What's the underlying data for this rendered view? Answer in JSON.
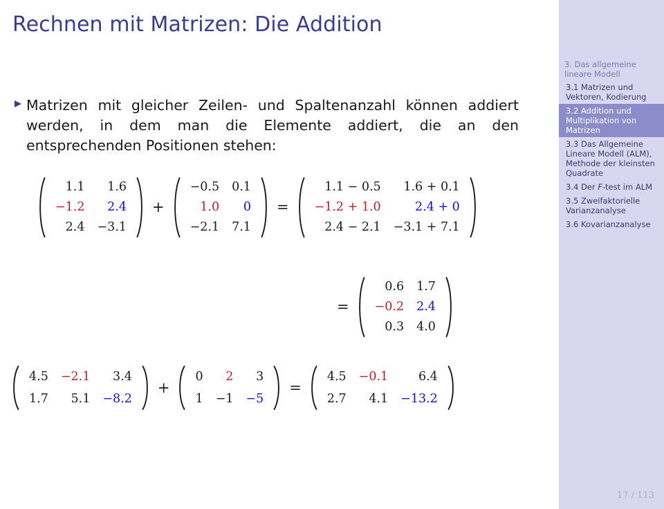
{
  "slide": {
    "title": "Rechnen mit Matrizen: Die Addition",
    "page_number": "17 / 113"
  },
  "bullet": {
    "marker": "triangle-right-bullet",
    "text": "Matrizen mit gleicher Zeilen- und Spaltenanzahl können addiert werden, in dem man die Elemente addiert, die an den entsprechenden Positionen stehen:"
  },
  "colors": {
    "title": "#3b3b8f",
    "bullet_marker": "#3b3b8f",
    "sidebar_bg": "#d7d7ef",
    "sidebar_active_bg": "#8c8cca",
    "sidebar_section": "#7a7ab8",
    "sidebar_item": "#3b3b6b",
    "math_red": "#c01c28",
    "math_blue": "#1111cc",
    "math_black": "#1a1a1a",
    "page_number": "#a9a9cc"
  },
  "sidebar": {
    "section": "3. Das allgemeine lineare Modell",
    "items": [
      {
        "label": "3.1 Matrizen und Vektoren, Kodierung",
        "active": false
      },
      {
        "label": "3.2 Addition und Multiplikation von Matrizen",
        "active": true
      },
      {
        "label": "3.3 Das Allgemeine Lineare Modell (ALM), Methode der kleinsten Quadrate",
        "active": false
      },
      {
        "label": "3.4 Der F-test im ALM",
        "active": false,
        "italic_part": "F"
      },
      {
        "label": "3.5 Zweifaktorielle Varianzanalyse",
        "active": false
      },
      {
        "label": "3.6 Kovarianzanalyse",
        "active": false
      }
    ]
  },
  "equations": [
    {
      "id": "equation-1",
      "terms": [
        {
          "kind": "matrix",
          "rows": 3,
          "cols": 2,
          "cells": [
            [
              {
                "t": "1.1",
                "c": "blk"
              },
              {
                "t": "1.6",
                "c": "blk"
              }
            ],
            [
              {
                "t": "−1.2",
                "c": "red"
              },
              {
                "t": "2.4",
                "c": "blue"
              }
            ],
            [
              {
                "t": "2.4",
                "c": "blk"
              },
              {
                "t": "−3.1",
                "c": "blk"
              }
            ]
          ]
        },
        {
          "kind": "op",
          "t": "+"
        },
        {
          "kind": "matrix",
          "rows": 3,
          "cols": 2,
          "cells": [
            [
              {
                "t": "−0.5",
                "c": "blk"
              },
              {
                "t": "0.1",
                "c": "blk"
              }
            ],
            [
              {
                "t": "1.0",
                "c": "red"
              },
              {
                "t": "0",
                "c": "blue"
              }
            ],
            [
              {
                "t": "−2.1",
                "c": "blk"
              },
              {
                "t": "7.1",
                "c": "blk"
              }
            ]
          ]
        },
        {
          "kind": "op",
          "t": "="
        },
        {
          "kind": "matrix",
          "rows": 3,
          "cols": 2,
          "cells": [
            [
              {
                "t": "1.1 − 0.5",
                "c": "blk"
              },
              {
                "t": "1.6 + 0.1",
                "c": "blk"
              }
            ],
            [
              {
                "t": "−1.2 + 1.0",
                "c": "red"
              },
              {
                "t": "2.4 + 0",
                "c": "blue"
              }
            ],
            [
              {
                "t": "2.4 − 2.1",
                "c": "blk"
              },
              {
                "t": "−3.1 + 7.1",
                "c": "blk"
              }
            ]
          ]
        }
      ]
    },
    {
      "id": "equation-2",
      "terms": [
        {
          "kind": "op",
          "t": "="
        },
        {
          "kind": "matrix",
          "rows": 3,
          "cols": 2,
          "cells": [
            [
              {
                "t": "0.6",
                "c": "blk"
              },
              {
                "t": "1.7",
                "c": "blk"
              }
            ],
            [
              {
                "t": "−0.2",
                "c": "red"
              },
              {
                "t": "2.4",
                "c": "blue"
              }
            ],
            [
              {
                "t": "0.3",
                "c": "blk"
              },
              {
                "t": "4.0",
                "c": "blk"
              }
            ]
          ]
        }
      ]
    },
    {
      "id": "equation-3",
      "terms": [
        {
          "kind": "matrix",
          "rows": 2,
          "cols": 3,
          "cells": [
            [
              {
                "t": "4.5",
                "c": "blk"
              },
              {
                "t": "−2.1",
                "c": "red"
              },
              {
                "t": "3.4",
                "c": "blk"
              }
            ],
            [
              {
                "t": "1.7",
                "c": "blk"
              },
              {
                "t": "5.1",
                "c": "blk"
              },
              {
                "t": "−8.2",
                "c": "blue"
              }
            ]
          ]
        },
        {
          "kind": "op",
          "t": "+"
        },
        {
          "kind": "matrix",
          "rows": 2,
          "cols": 3,
          "cells": [
            [
              {
                "t": "0",
                "c": "blk"
              },
              {
                "t": "2",
                "c": "red"
              },
              {
                "t": "3",
                "c": "blk"
              }
            ],
            [
              {
                "t": "1",
                "c": "blk"
              },
              {
                "t": "−1",
                "c": "blk"
              },
              {
                "t": "−5",
                "c": "blue"
              }
            ]
          ]
        },
        {
          "kind": "op",
          "t": "="
        },
        {
          "kind": "matrix",
          "rows": 2,
          "cols": 3,
          "cells": [
            [
              {
                "t": "4.5",
                "c": "blk"
              },
              {
                "t": "−0.1",
                "c": "red"
              },
              {
                "t": "6.4",
                "c": "blk"
              }
            ],
            [
              {
                "t": "2.7",
                "c": "blk"
              },
              {
                "t": "4.1",
                "c": "blk"
              },
              {
                "t": "−13.2",
                "c": "blue"
              }
            ]
          ]
        }
      ]
    }
  ]
}
